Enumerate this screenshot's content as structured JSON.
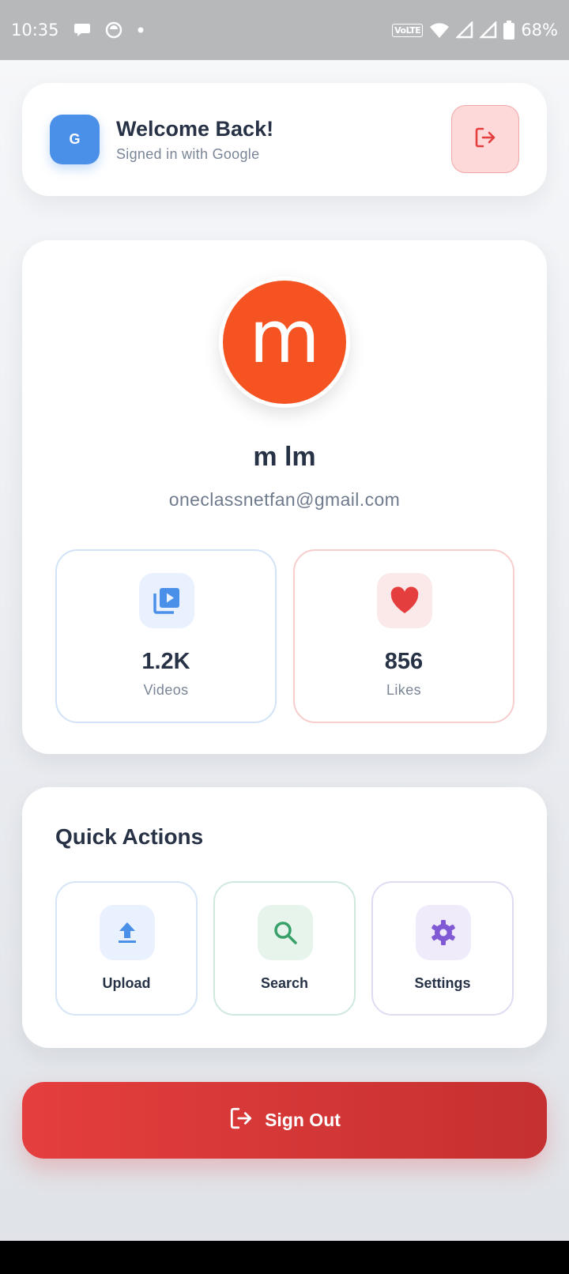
{
  "status_bar": {
    "time": "10:35",
    "network_tag": "VoLTE",
    "battery": "68%",
    "icons": [
      "chat-bubble-icon",
      "face-icon",
      "dot-icon",
      "wifi-icon",
      "signal-icon",
      "signal-icon",
      "battery-icon"
    ]
  },
  "welcome": {
    "badge_letter": "G",
    "title": "Welcome Back!",
    "subtitle": "Signed in with Google",
    "logout_icon": "logout-icon"
  },
  "profile": {
    "avatar_letter": "m",
    "avatar_color": "#f55321",
    "name": "m lm",
    "email": "oneclassnetfan@gmail.com",
    "stats": [
      {
        "value": "1.2K",
        "label": "Videos",
        "icon": "video-library-icon",
        "color": "#4a8fe8"
      },
      {
        "value": "856",
        "label": "Likes",
        "icon": "heart-icon",
        "color": "#e53e3e"
      }
    ]
  },
  "quick_actions": {
    "title": "Quick Actions",
    "items": [
      {
        "label": "Upload",
        "icon": "upload-icon",
        "color": "#4a8fe8"
      },
      {
        "label": "Search",
        "icon": "search-icon",
        "color": "#38a169"
      },
      {
        "label": "Settings",
        "icon": "gear-icon",
        "color": "#805ad5"
      }
    ]
  },
  "sign_out": {
    "label": "Sign Out",
    "icon": "logout-icon",
    "color": "#e53e3e"
  }
}
